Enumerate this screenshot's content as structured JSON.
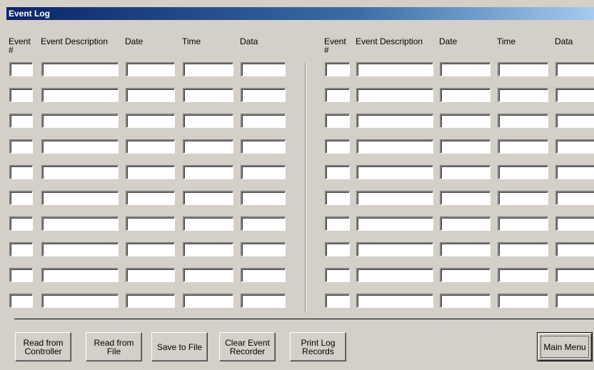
{
  "window": {
    "title": "Event Log"
  },
  "columns": {
    "event_num": "Event\n#",
    "description": "Event Description",
    "date": "Date",
    "time": "Time",
    "data": "Data"
  },
  "rows_per_panel": 10,
  "buttons": {
    "read_controller": "Read from\nController",
    "read_file": "Read from\nFile",
    "save_file": "Save to File",
    "clear_recorder": "Clear Event\nRecorder",
    "print_log": "Print Log\nRecords",
    "main_menu": "Main Menu"
  }
}
